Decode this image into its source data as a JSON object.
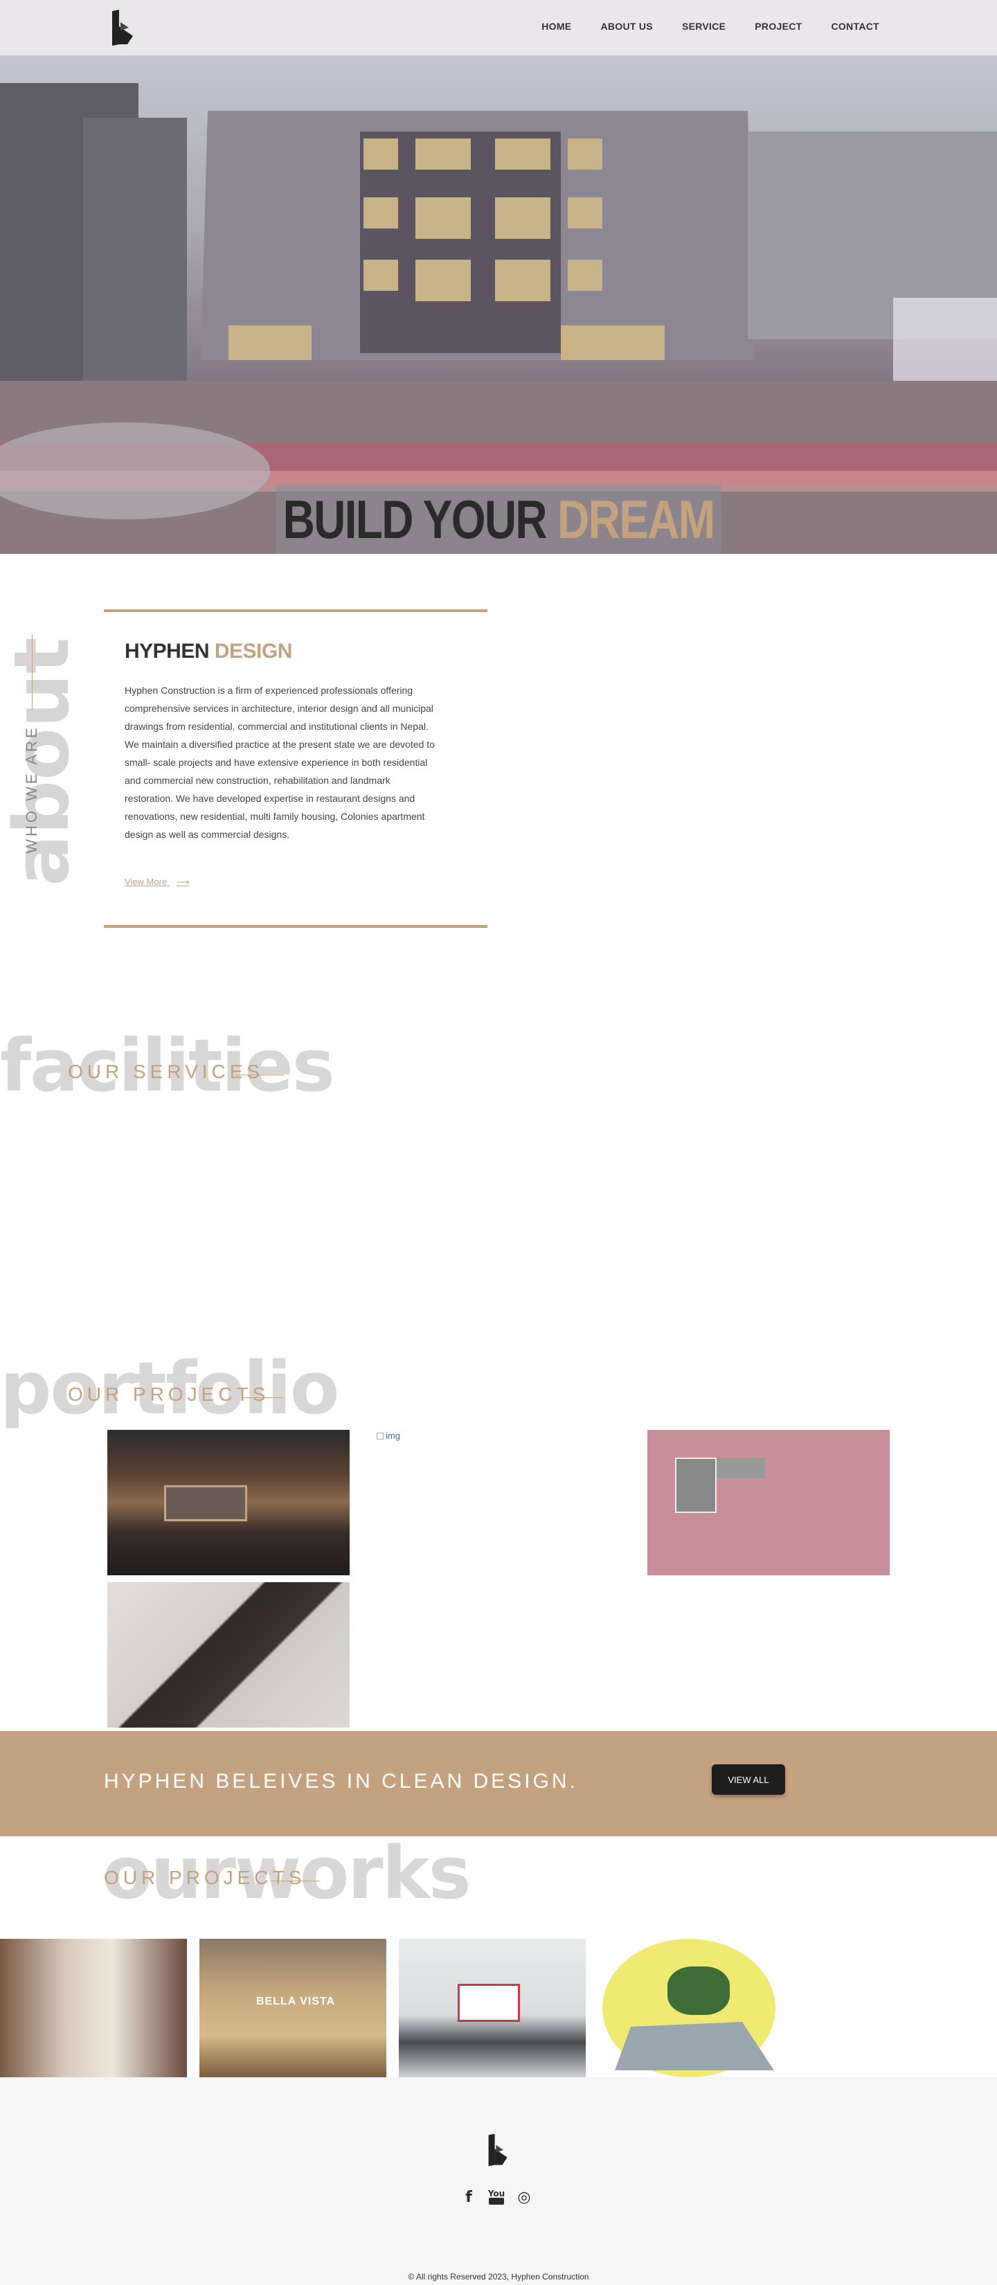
{
  "nav": {
    "items": [
      {
        "label": "HOME"
      },
      {
        "label": "ABOUT US"
      },
      {
        "label": "SERVICE"
      },
      {
        "label": "PROJECT"
      },
      {
        "label": "CONTACT"
      }
    ]
  },
  "hero": {
    "tagline_dark": "BUILD YOUR",
    "tagline_gold": "DREAM HOUSE"
  },
  "about": {
    "ghost": "about",
    "vertical_label": "WHO WE ARE",
    "title_dark": "HYPHEN",
    "title_gold": "DESIGN",
    "text": "Hyphen Construction is a firm of experienced professionals offering comprehensive services in architecture, interior design and all municipal drawings from residential, commercial and institutional clients in Nepal. We maintain a diversified practice at the present state we are devoted to small- scale projects and have extensive experience in both residential and commercial new construction, rehabilitation and landmark restoration. We have developed expertise in restaurant designs and renovations, new residential, multi family housing, Colonies apartment design as well as commercial designs.",
    "more_label": "View More",
    "more_arrow": "⟶"
  },
  "services": {
    "ghost": "facilities",
    "label": "OUR SERVICES"
  },
  "portfolio": {
    "ghost": "portfolio",
    "label": "OUR PROJECTS",
    "broken_alt": "img"
  },
  "banner": {
    "text": "HYPHEN BELEIVES IN CLEAN DESIGN.",
    "button": "VIEW ALL"
  },
  "works": {
    "ghost": "ourworks",
    "label": "OUR PROJECTS",
    "sign": "BELLA VISTA"
  },
  "footer": {
    "social": [
      {
        "icon": "facebook-icon",
        "glyph": "f"
      },
      {
        "icon": "youtube-icon",
        "glyph": "You"
      },
      {
        "icon": "instagram-icon",
        "glyph": "◎"
      }
    ],
    "copyright": "© All rights Reserved 2023, Hyphen Construction"
  },
  "colors": {
    "accent": "#c5a27f",
    "dark": "#1e1e1e",
    "ghost": "#d7d7d7"
  }
}
